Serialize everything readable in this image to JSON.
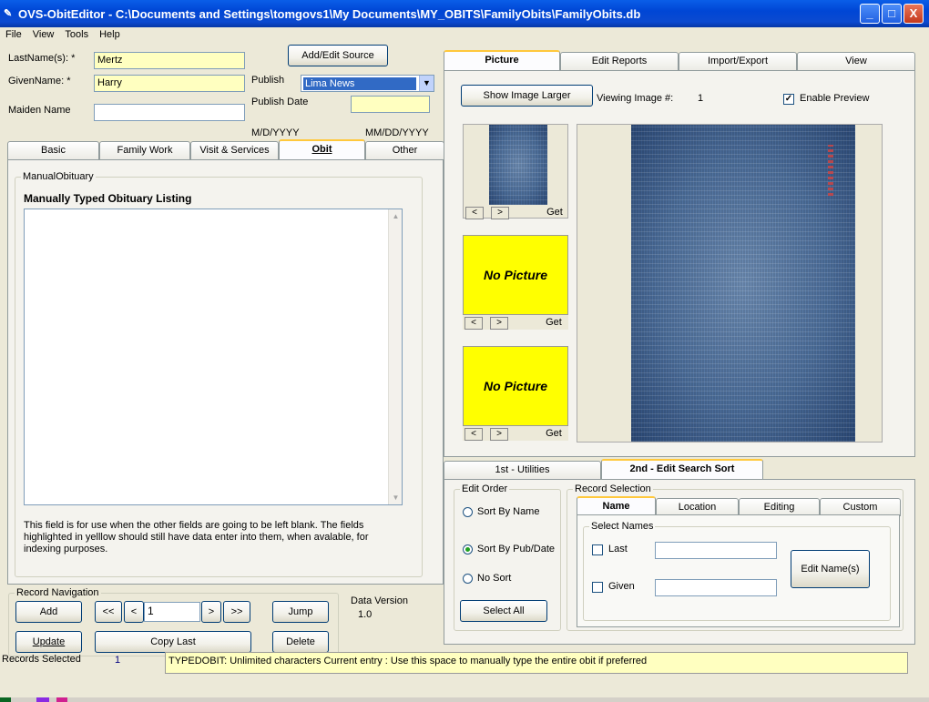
{
  "window": {
    "title": "OVS-ObitEditor - C:\\Documents and Settings\\tomgovs1\\My Documents\\MY_OBITS\\FamilyObits\\FamilyObits.db",
    "buttons": {
      "minimize": "_",
      "maximize": "□",
      "close": "X"
    }
  },
  "menu": [
    "File",
    "View",
    "Tools",
    "Help"
  ],
  "fields": {
    "last_name_label": "LastName(s): *",
    "last_name": "Mertz",
    "given_name_label": "GivenName: *",
    "given_name": "Harry",
    "maiden_name_label": "Maiden Name",
    "maiden_name": "",
    "add_edit_source": "Add/Edit Source",
    "publish_label": "Publish",
    "publish_value": "Lima News",
    "publish_date_label": "Publish Date",
    "publish_date": "",
    "date_hint_1": "M/D/YYYY",
    "date_hint_2": "MM/DD/YYYY"
  },
  "left_tabs": [
    "Basic",
    "Family Work",
    "Visit & Services",
    "Obit",
    "Other"
  ],
  "obit": {
    "group_label": "ManualObituary",
    "heading": "Manually Typed Obituary Listing",
    "text": "",
    "help": "This field is for use when the other fields are going to be left blank.  The fields highlighted in yelllow should still have data enter into them, when avalable, for indexing purposes."
  },
  "record_nav": {
    "group_label": "Record Navigation",
    "add": "Add",
    "update": "Update",
    "first": "<<",
    "prev": "<",
    "record_number": "1",
    "next": ">",
    "last": ">>",
    "jump": "Jump",
    "copy_last": "Copy Last",
    "delete": "Delete",
    "data_version_label": "Data Version",
    "data_version": "1.0"
  },
  "status": {
    "records_selected_label": "Records Selected",
    "records_selected": "1",
    "message": "TYPEDOBIT: Unlimited characters Current entry : Use this space to manually type the entire obit if preferred"
  },
  "right_tabs": [
    "Picture",
    "Edit Reports",
    "Import/Export",
    "View"
  ],
  "picture": {
    "show_larger": "Show Image Larger",
    "viewing_label": "Viewing Image #:",
    "viewing_number": "1",
    "enable_preview": "Enable Preview",
    "enable_preview_checked": true,
    "no_picture": "No Picture",
    "prev": "<",
    "next": ">",
    "get": "Get"
  },
  "bottom_tabs": [
    "1st - Utilities",
    "2nd - Edit Search Sort"
  ],
  "edit_order": {
    "group_label": "Edit Order",
    "sort_by_name": "Sort By Name",
    "sort_by_pub": "Sort By Pub/Date",
    "no_sort": "No Sort",
    "select_all": "Select All",
    "selected": "sort_by_pub"
  },
  "record_selection": {
    "group_label": "Record Selection",
    "tabs": [
      "Name",
      "Location",
      "Editing",
      "Custom"
    ],
    "select_names": "Select Names",
    "last": "Last",
    "given": "Given",
    "edit_names": "Edit Name(s)"
  },
  "colors": {
    "required_field": "#ffffc0",
    "no_picture": "#ffff00",
    "titlebar": "#0046d5"
  },
  "icons": {
    "app": "pen-icon",
    "dropdown": "chevron-down-icon",
    "check": "checkmark-icon"
  }
}
